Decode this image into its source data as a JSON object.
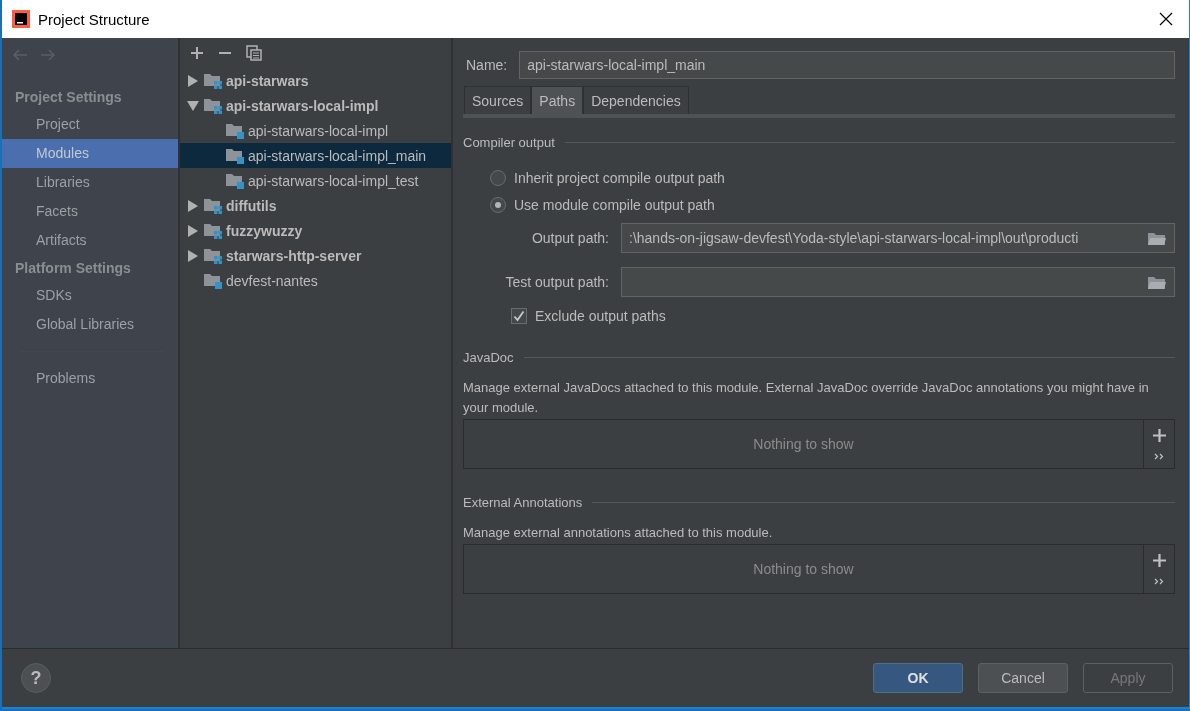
{
  "window": {
    "title": "Project Structure"
  },
  "sidebar": {
    "sections": [
      {
        "header": "Project Settings",
        "items": [
          {
            "label": "Project",
            "selected": false
          },
          {
            "label": "Modules",
            "selected": true
          },
          {
            "label": "Libraries",
            "selected": false
          },
          {
            "label": "Facets",
            "selected": false
          },
          {
            "label": "Artifacts",
            "selected": false
          }
        ]
      },
      {
        "header": "Platform Settings",
        "items": [
          {
            "label": "SDKs",
            "selected": false
          },
          {
            "label": "Global Libraries",
            "selected": false
          }
        ]
      },
      {
        "items": [
          {
            "label": "Problems",
            "selected": false
          }
        ]
      }
    ]
  },
  "tree": {
    "items": [
      {
        "label": "api-starwars",
        "kind": "module",
        "expanded": false,
        "selected": false
      },
      {
        "label": "api-starwars-local-impl",
        "kind": "module",
        "expanded": true,
        "selected": false,
        "children": [
          {
            "label": "api-starwars-local-impl",
            "kind": "source-set",
            "selected": false
          },
          {
            "label": "api-starwars-local-impl_main",
            "kind": "source-set",
            "selected": true
          },
          {
            "label": "api-starwars-local-impl_test",
            "kind": "source-set",
            "selected": false
          }
        ]
      },
      {
        "label": "diffutils",
        "kind": "module",
        "expanded": false,
        "selected": false
      },
      {
        "label": "fuzzywuzzy",
        "kind": "module",
        "expanded": false,
        "selected": false
      },
      {
        "label": "starwars-http-server",
        "kind": "module",
        "expanded": false,
        "selected": false
      },
      {
        "label": "devfest-nantes",
        "kind": "source-set",
        "selected": false
      }
    ]
  },
  "editor": {
    "name_label": "Name:",
    "name_value": "api-starwars-local-impl_main",
    "tabs": [
      {
        "label": "Sources",
        "selected": false
      },
      {
        "label": "Paths",
        "selected": true
      },
      {
        "label": "Dependencies",
        "selected": false
      }
    ],
    "compiler_output": {
      "title": "Compiler output",
      "options": [
        {
          "label": "Inherit project compile output path",
          "selected": false
        },
        {
          "label": "Use module compile output path",
          "selected": true
        }
      ],
      "output_path": {
        "label": "Output path:",
        "value": ":\\hands-on-jigsaw-devfest\\Yoda-style\\api-starwars-local-impl\\out\\producti"
      },
      "test_output_path": {
        "label": "Test output path:"
      },
      "exclude": {
        "label": "Exclude output paths",
        "checked": true
      }
    },
    "sections": [
      {
        "title": "JavaDoc",
        "description": "Manage external JavaDocs attached to this module. External JavaDoc override JavaDoc annotations you might have in your module.",
        "empty_text": "Nothing to show"
      },
      {
        "title": "External Annotations",
        "description": "Manage external annotations attached to this module.",
        "empty_text": "Nothing to show"
      }
    ]
  },
  "footer": {
    "help": "?",
    "buttons": [
      {
        "label": "OK",
        "kind": "primary",
        "disabled": false
      },
      {
        "label": "Cancel",
        "kind": "normal",
        "disabled": false
      },
      {
        "label": "Apply",
        "kind": "normal",
        "disabled": true
      }
    ]
  }
}
